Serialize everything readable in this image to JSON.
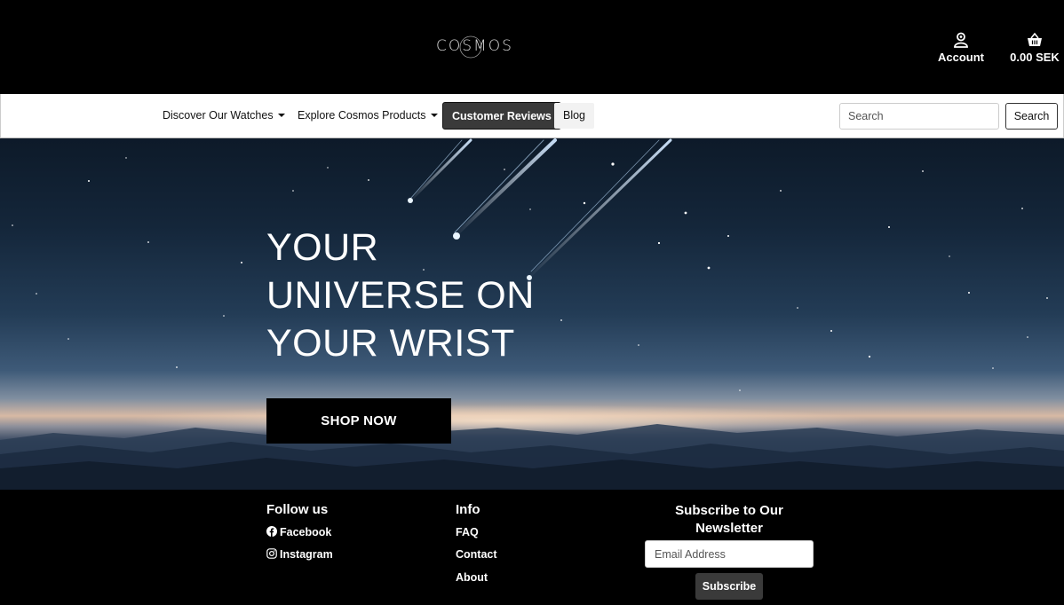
{
  "header": {
    "logo_text": "COSMOS",
    "account_label": "Account",
    "cart_total": "0.00 SEK"
  },
  "nav": {
    "items": [
      {
        "label": "Discover Our Watches",
        "dropdown": true
      },
      {
        "label": "Explore Cosmos Products",
        "dropdown": true
      },
      {
        "label": "Customer Reviews",
        "active": true
      },
      {
        "label": "Blog"
      }
    ],
    "search": {
      "placeholder": "Search",
      "button_label": "Search"
    }
  },
  "hero": {
    "title": "YOUR\nUNIVERSE ON\nYOUR WRIST",
    "cta_label": "SHOP NOW"
  },
  "footer": {
    "follow": {
      "heading": "Follow us",
      "links": [
        {
          "icon": "facebook-icon",
          "label": "Facebook"
        },
        {
          "icon": "instagram-icon",
          "label": "Instagram"
        }
      ]
    },
    "info": {
      "heading": "Info",
      "links": [
        "FAQ",
        "Contact",
        "About"
      ]
    },
    "newsletter": {
      "heading": "Subscribe to Our Newsletter",
      "email_placeholder": "Email Address",
      "button_label": "Subscribe"
    }
  },
  "colors": {
    "header_bg": "#000000",
    "nav_bg": "#ffffff",
    "active_nav_bg": "#3a3a3a",
    "button_bg": "#000000"
  }
}
